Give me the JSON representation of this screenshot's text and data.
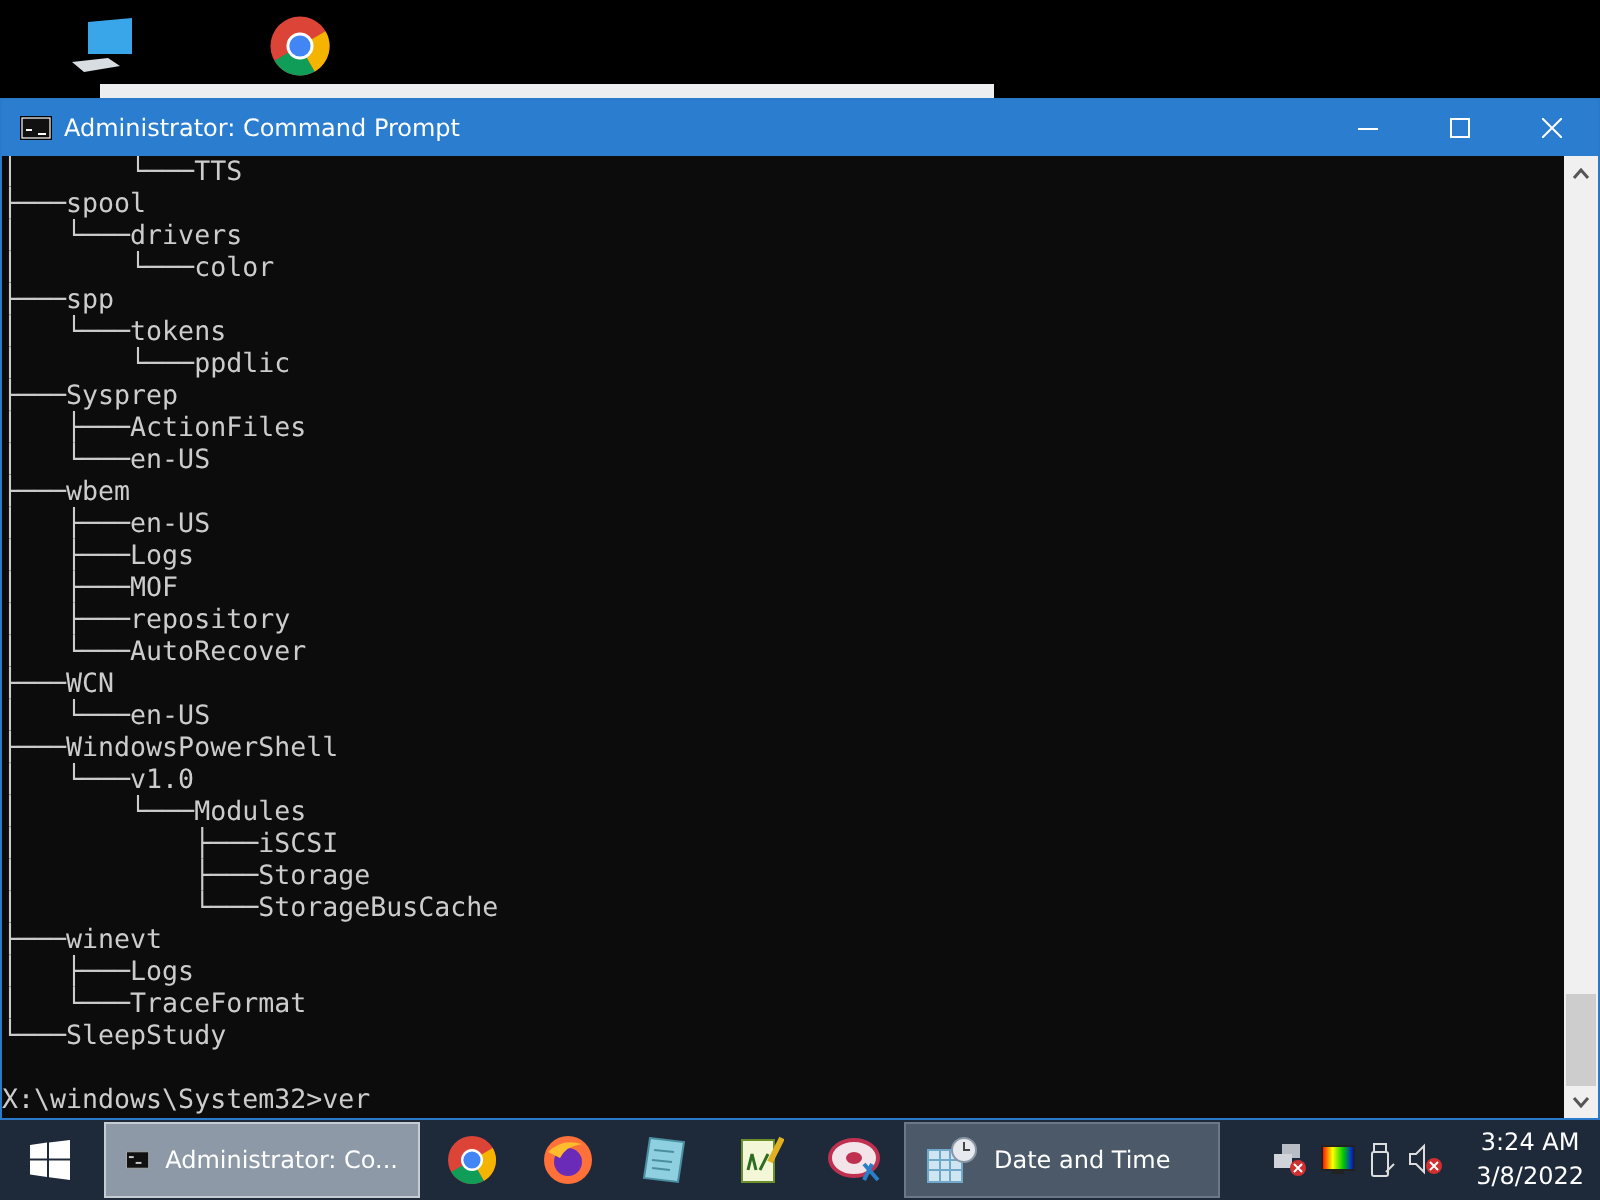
{
  "window": {
    "title": "Administrator: Command Prompt"
  },
  "console": {
    "lines": [
      "│       └───TTS",
      "├───spool",
      "│   └───drivers",
      "│       └───color",
      "├───spp",
      "│   └───tokens",
      "│       └───ppdlic",
      "├───Sysprep",
      "│   ├───ActionFiles",
      "│   └───en-US",
      "├───wbem",
      "│   ├───en-US",
      "│   ├───Logs",
      "│   ├───MOF",
      "│   ├───repository",
      "│   └───AutoRecover",
      "├───WCN",
      "│   └───en-US",
      "├───WindowsPowerShell",
      "│   └───v1.0",
      "│       └───Modules",
      "│           ├───iSCSI",
      "│           ├───Storage",
      "│           └───StorageBusCache",
      "├───winevt",
      "│   ├───Logs",
      "│   └───TraceFormat",
      "└───SleepStudy"
    ],
    "prompt": "X:\\windows\\System32>ver"
  },
  "taskbar": {
    "items": [
      {
        "kind": "window",
        "label": "Administrator: Co...",
        "selected": true
      },
      {
        "kind": "pin",
        "selected": false
      },
      {
        "kind": "pin",
        "selected": false
      },
      {
        "kind": "pin",
        "selected": false
      },
      {
        "kind": "pin",
        "selected": false
      },
      {
        "kind": "pin",
        "selected": false
      },
      {
        "kind": "window",
        "label": "Date and Time",
        "selected": false
      }
    ],
    "time": "3:24 AM",
    "date": "3/8/2022"
  }
}
